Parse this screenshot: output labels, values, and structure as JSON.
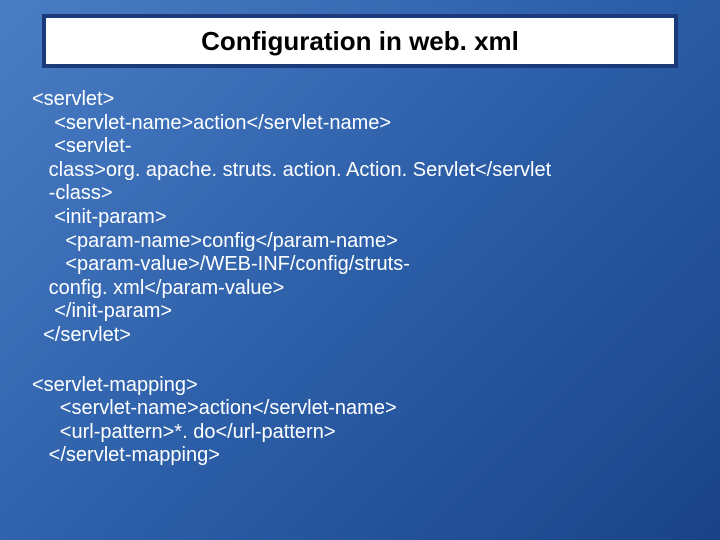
{
  "title": "Configuration in web. xml",
  "code1": {
    "l1": "<servlet>",
    "l2": "    <servlet-name>action</servlet-name>",
    "l3": "    <servlet-",
    "l4": "   class>org. apache. struts. action. Action. Servlet</servlet",
    "l5": "   -class>",
    "l6": "    <init-param>",
    "l7": "      <param-name>config</param-name>",
    "l8": "      <param-value>/WEB-INF/config/struts-",
    "l9": "   config. xml</param-value>",
    "l10": "    </init-param>",
    "l11": "  </servlet>"
  },
  "code2": {
    "l1": "<servlet-mapping>",
    "l2": "     <servlet-name>action</servlet-name>",
    "l3": "     <url-pattern>*. do</url-pattern>",
    "l4": "   </servlet-mapping>"
  }
}
